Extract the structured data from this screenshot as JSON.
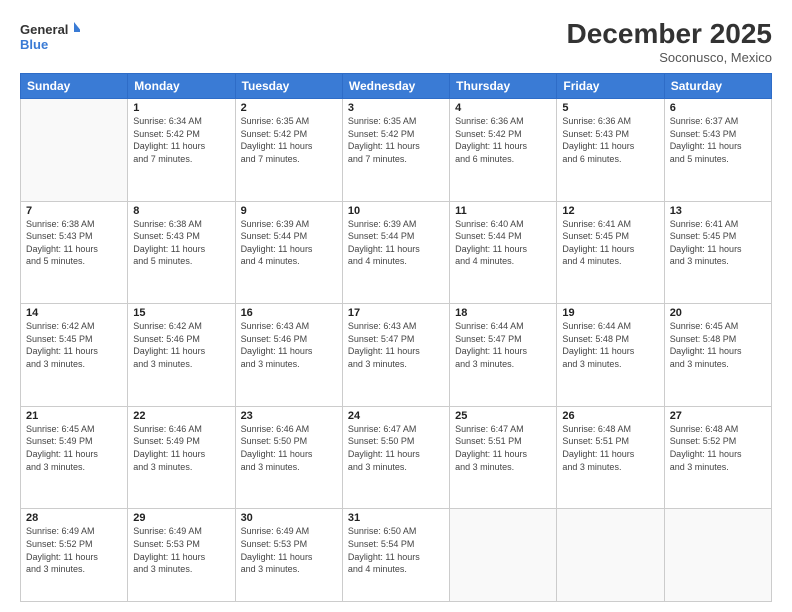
{
  "header": {
    "logo_general": "General",
    "logo_blue": "Blue",
    "month_title": "December 2025",
    "location": "Soconusco, Mexico"
  },
  "weekdays": [
    "Sunday",
    "Monday",
    "Tuesday",
    "Wednesday",
    "Thursday",
    "Friday",
    "Saturday"
  ],
  "weeks": [
    [
      {
        "day": "",
        "info": ""
      },
      {
        "day": "1",
        "info": "Sunrise: 6:34 AM\nSunset: 5:42 PM\nDaylight: 11 hours\nand 7 minutes."
      },
      {
        "day": "2",
        "info": "Sunrise: 6:35 AM\nSunset: 5:42 PM\nDaylight: 11 hours\nand 7 minutes."
      },
      {
        "day": "3",
        "info": "Sunrise: 6:35 AM\nSunset: 5:42 PM\nDaylight: 11 hours\nand 7 minutes."
      },
      {
        "day": "4",
        "info": "Sunrise: 6:36 AM\nSunset: 5:42 PM\nDaylight: 11 hours\nand 6 minutes."
      },
      {
        "day": "5",
        "info": "Sunrise: 6:36 AM\nSunset: 5:43 PM\nDaylight: 11 hours\nand 6 minutes."
      },
      {
        "day": "6",
        "info": "Sunrise: 6:37 AM\nSunset: 5:43 PM\nDaylight: 11 hours\nand 5 minutes."
      }
    ],
    [
      {
        "day": "7",
        "info": "Sunrise: 6:38 AM\nSunset: 5:43 PM\nDaylight: 11 hours\nand 5 minutes."
      },
      {
        "day": "8",
        "info": "Sunrise: 6:38 AM\nSunset: 5:43 PM\nDaylight: 11 hours\nand 5 minutes."
      },
      {
        "day": "9",
        "info": "Sunrise: 6:39 AM\nSunset: 5:44 PM\nDaylight: 11 hours\nand 4 minutes."
      },
      {
        "day": "10",
        "info": "Sunrise: 6:39 AM\nSunset: 5:44 PM\nDaylight: 11 hours\nand 4 minutes."
      },
      {
        "day": "11",
        "info": "Sunrise: 6:40 AM\nSunset: 5:44 PM\nDaylight: 11 hours\nand 4 minutes."
      },
      {
        "day": "12",
        "info": "Sunrise: 6:41 AM\nSunset: 5:45 PM\nDaylight: 11 hours\nand 4 minutes."
      },
      {
        "day": "13",
        "info": "Sunrise: 6:41 AM\nSunset: 5:45 PM\nDaylight: 11 hours\nand 3 minutes."
      }
    ],
    [
      {
        "day": "14",
        "info": "Sunrise: 6:42 AM\nSunset: 5:45 PM\nDaylight: 11 hours\nand 3 minutes."
      },
      {
        "day": "15",
        "info": "Sunrise: 6:42 AM\nSunset: 5:46 PM\nDaylight: 11 hours\nand 3 minutes."
      },
      {
        "day": "16",
        "info": "Sunrise: 6:43 AM\nSunset: 5:46 PM\nDaylight: 11 hours\nand 3 minutes."
      },
      {
        "day": "17",
        "info": "Sunrise: 6:43 AM\nSunset: 5:47 PM\nDaylight: 11 hours\nand 3 minutes."
      },
      {
        "day": "18",
        "info": "Sunrise: 6:44 AM\nSunset: 5:47 PM\nDaylight: 11 hours\nand 3 minutes."
      },
      {
        "day": "19",
        "info": "Sunrise: 6:44 AM\nSunset: 5:48 PM\nDaylight: 11 hours\nand 3 minutes."
      },
      {
        "day": "20",
        "info": "Sunrise: 6:45 AM\nSunset: 5:48 PM\nDaylight: 11 hours\nand 3 minutes."
      }
    ],
    [
      {
        "day": "21",
        "info": "Sunrise: 6:45 AM\nSunset: 5:49 PM\nDaylight: 11 hours\nand 3 minutes."
      },
      {
        "day": "22",
        "info": "Sunrise: 6:46 AM\nSunset: 5:49 PM\nDaylight: 11 hours\nand 3 minutes."
      },
      {
        "day": "23",
        "info": "Sunrise: 6:46 AM\nSunset: 5:50 PM\nDaylight: 11 hours\nand 3 minutes."
      },
      {
        "day": "24",
        "info": "Sunrise: 6:47 AM\nSunset: 5:50 PM\nDaylight: 11 hours\nand 3 minutes."
      },
      {
        "day": "25",
        "info": "Sunrise: 6:47 AM\nSunset: 5:51 PM\nDaylight: 11 hours\nand 3 minutes."
      },
      {
        "day": "26",
        "info": "Sunrise: 6:48 AM\nSunset: 5:51 PM\nDaylight: 11 hours\nand 3 minutes."
      },
      {
        "day": "27",
        "info": "Sunrise: 6:48 AM\nSunset: 5:52 PM\nDaylight: 11 hours\nand 3 minutes."
      }
    ],
    [
      {
        "day": "28",
        "info": "Sunrise: 6:49 AM\nSunset: 5:52 PM\nDaylight: 11 hours\nand 3 minutes."
      },
      {
        "day": "29",
        "info": "Sunrise: 6:49 AM\nSunset: 5:53 PM\nDaylight: 11 hours\nand 3 minutes."
      },
      {
        "day": "30",
        "info": "Sunrise: 6:49 AM\nSunset: 5:53 PM\nDaylight: 11 hours\nand 3 minutes."
      },
      {
        "day": "31",
        "info": "Sunrise: 6:50 AM\nSunset: 5:54 PM\nDaylight: 11 hours\nand 4 minutes."
      },
      {
        "day": "",
        "info": ""
      },
      {
        "day": "",
        "info": ""
      },
      {
        "day": "",
        "info": ""
      }
    ]
  ]
}
